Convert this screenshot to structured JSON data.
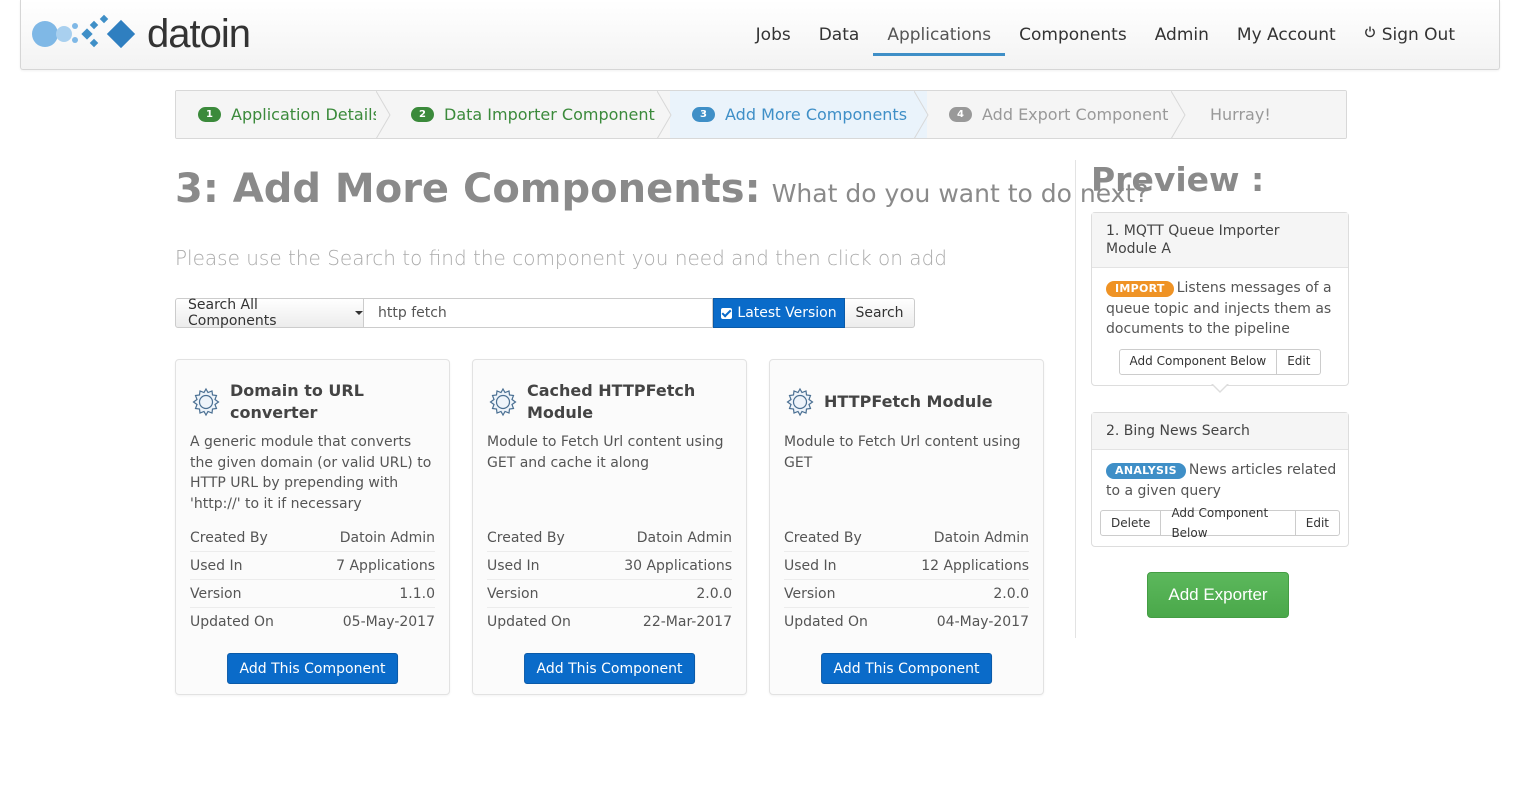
{
  "brand": {
    "name": "datoin"
  },
  "nav": {
    "items": [
      {
        "label": "Jobs"
      },
      {
        "label": "Data"
      },
      {
        "label": "Applications",
        "active": true
      },
      {
        "label": "Components"
      },
      {
        "label": "Admin"
      },
      {
        "label": "My Account"
      }
    ],
    "sign_out": "Sign Out"
  },
  "wizard": {
    "steps": [
      {
        "num": "1",
        "label": "Application Details",
        "state": "done"
      },
      {
        "num": "2",
        "label": "Data Importer Component",
        "state": "done"
      },
      {
        "num": "3",
        "label": "Add More Components",
        "state": "current"
      },
      {
        "num": "4",
        "label": "Add Export Component",
        "state": "todo"
      },
      {
        "num": "",
        "label": "Hurray!",
        "state": "todo"
      }
    ]
  },
  "main": {
    "title": "3: Add More Components:",
    "subtitle": "What do you want to do next?",
    "instructions": "Please use the Search to find the component you need and then click on add",
    "search": {
      "scope_label": "Search All Components",
      "query": "http fetch",
      "latest_label": "Latest Version",
      "latest_checked": true,
      "button": "Search"
    },
    "meta_labels": {
      "created_by": "Created By",
      "used_in": "Used In",
      "version": "Version",
      "updated_on": "Updated On"
    },
    "add_label": "Add This Component",
    "cards": [
      {
        "title": "Domain to URL converter",
        "description": "A generic module that converts the given domain (or valid URL) to HTTP URL by prepending with 'http://' to it if necessary",
        "created_by": "Datoin Admin",
        "used_in": "7 Applications",
        "version": "1.1.0",
        "updated_on": "05-May-2017"
      },
      {
        "title": "Cached HTTPFetch Module",
        "description": "Module to Fetch Url content using GET and cache it along",
        "created_by": "Datoin Admin",
        "used_in": "30 Applications",
        "version": "2.0.0",
        "updated_on": "22-Mar-2017"
      },
      {
        "title": "HTTPFetch Module",
        "description": "Module to Fetch Url content using GET",
        "created_by": "Datoin Admin",
        "used_in": "12 Applications",
        "version": "2.0.0",
        "updated_on": "04-May-2017"
      }
    ]
  },
  "preview": {
    "title": "Preview :",
    "items": [
      {
        "header": "1. MQTT Queue Importer Module A",
        "tag": "IMPORT",
        "description": "Listens messages of a queue topic and injects them as documents to the pipeline",
        "buttons": [
          "Add Component Below",
          "Edit"
        ]
      },
      {
        "header": "2. Bing News Search",
        "tag": "ANALYSIS",
        "description": "News articles related to a given query",
        "buttons": [
          "Delete",
          "Add Component Below",
          "Edit"
        ]
      }
    ],
    "exporter_button": "Add Exporter"
  },
  "colors": {
    "primary": "#0a6bc9",
    "success": "#5cb85c",
    "step_done": "#3b8a3b",
    "step_current": "#3f8fc7",
    "tag_import": "#ef9325",
    "tag_analysis": "#3f8fc7"
  }
}
